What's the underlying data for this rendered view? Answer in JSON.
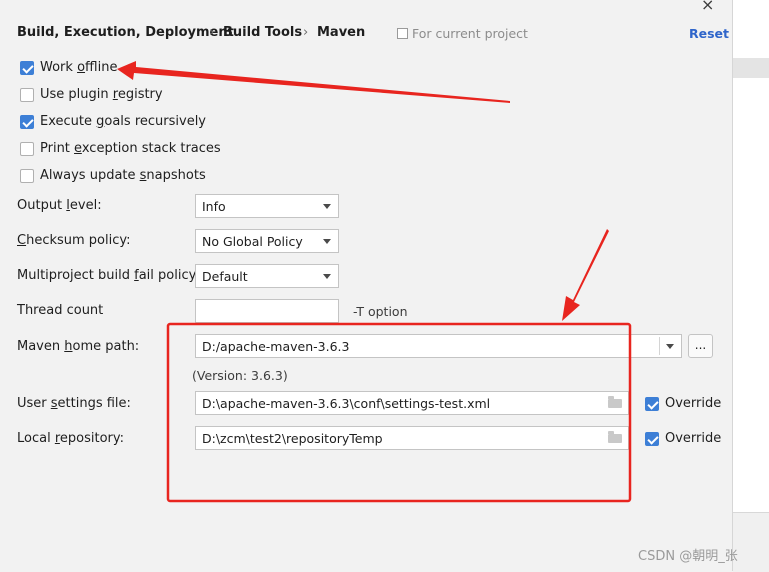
{
  "breadcrumb": {
    "part1": "Build, Execution, Deployment",
    "part2": "Build Tools",
    "part3": "Maven",
    "separator": "›"
  },
  "scope_label": "For current project",
  "reset_label": "Reset",
  "close_glyph": "×",
  "checkboxes": [
    {
      "pre": "Work ",
      "mn": "o",
      "post": "ffline",
      "checked": true
    },
    {
      "pre": "Use plugin ",
      "mn": "r",
      "post": "egistry",
      "checked": false
    },
    {
      "pre": "Execute ",
      "mn": "g",
      "post": "oals recursively",
      "checked": true
    },
    {
      "pre": "Print ",
      "mn": "e",
      "post": "xception stack traces",
      "checked": false
    },
    {
      "pre": "Always update ",
      "mn": "s",
      "post": "napshots",
      "checked": false
    }
  ],
  "output_level": {
    "pre": "Output ",
    "mn": "l",
    "post": "evel:",
    "value": "Info"
  },
  "checksum_policy": {
    "pre": "",
    "mn": "C",
    "post": "hecksum policy:",
    "value": "No Global Policy"
  },
  "fail_policy": {
    "pre": "Multiproject build ",
    "mn": "f",
    "post": "ail policy:",
    "value": "Default"
  },
  "thread_count": {
    "label": "Thread count",
    "value": "",
    "hint": "-T option"
  },
  "maven_home": {
    "pre": "Maven ",
    "mn": "h",
    "post": "ome path:",
    "value": "D:/apache-maven-3.6.3",
    "version": "(Version: 3.6.3)",
    "browse": "..."
  },
  "user_settings": {
    "pre": "User ",
    "mn": "s",
    "post": "ettings file:",
    "value": "D:\\apache-maven-3.6.3\\conf\\settings-test.xml",
    "override_label": "Override",
    "override": true
  },
  "local_repo": {
    "pre": "Local ",
    "mn": "r",
    "post": "epository:",
    "value": "D:\\zcm\\test2\\repositoryTemp",
    "override_label": "Override",
    "override": true
  },
  "watermark": "CSDN @朝明_张",
  "colors": {
    "annotation": "#e8251f",
    "accent": "#2f65ca",
    "checkbox": "#3d7fd6"
  }
}
